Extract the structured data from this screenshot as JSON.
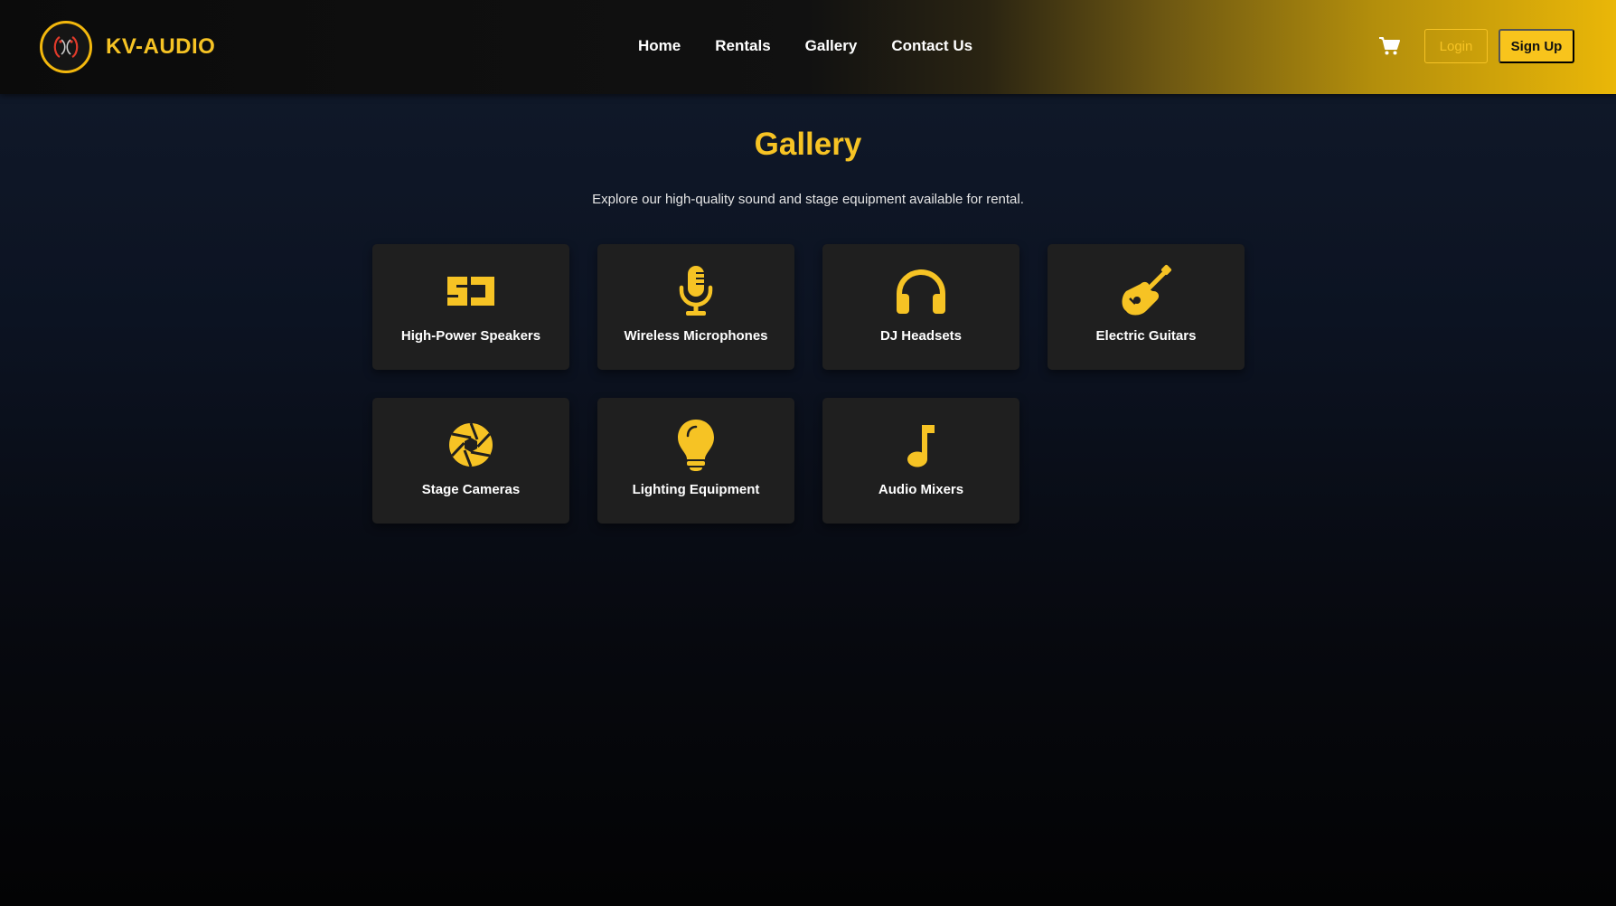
{
  "header": {
    "brand": "KV-AUDIO",
    "logo_icon": "headset-face-logo-icon",
    "nav": [
      {
        "label": "Home"
      },
      {
        "label": "Rentals"
      },
      {
        "label": "Gallery"
      },
      {
        "label": "Contact Us"
      }
    ],
    "cart_icon": "cart-icon",
    "login_label": "Login",
    "signup_label": "Sign Up"
  },
  "main": {
    "title": "Gallery",
    "subtitle": "Explore our high-quality sound and stage equipment available for rental.",
    "items": [
      {
        "label": "High-Power Speakers",
        "icon": "speaker-icon"
      },
      {
        "label": "Wireless Microphones",
        "icon": "microphone-icon"
      },
      {
        "label": "DJ Headsets",
        "icon": "headphones-icon"
      },
      {
        "label": "Electric Guitars",
        "icon": "guitar-icon"
      },
      {
        "label": "Stage Cameras",
        "icon": "camera-aperture-icon"
      },
      {
        "label": "Lighting Equipment",
        "icon": "lightbulb-icon"
      },
      {
        "label": "Audio Mixers",
        "icon": "music-note-icon"
      }
    ]
  },
  "colors": {
    "accent": "#f6c324",
    "card_bg": "#1f1f1f",
    "text": "#ffffff"
  }
}
